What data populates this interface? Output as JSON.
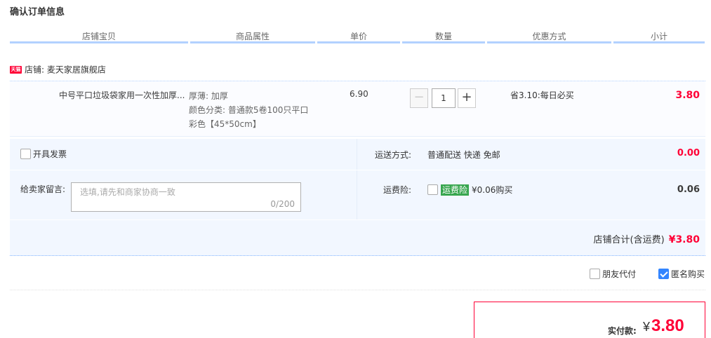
{
  "page_title": "确认订单信息",
  "columns": [
    "店铺宝贝",
    "商品属性",
    "单价",
    "数量",
    "优惠方式",
    "小计"
  ],
  "shop": {
    "badge": "天猫",
    "label": "店铺: 麦天家居旗舰店"
  },
  "item": {
    "title": "中号平口垃圾袋家用一次性加厚...",
    "attrs": [
      "厚薄: 加厚",
      "颜色分类: 普通款5卷100只平口",
      "彩色【45*50cm】"
    ],
    "price": "6.90",
    "quantity": "1",
    "minus": "−",
    "plus": "+",
    "promo": "省3.10:每日必买",
    "subtotal": "3.80"
  },
  "invoice": {
    "label": "开具发票",
    "checked": false
  },
  "shipping": {
    "label": "运送方式:",
    "value": "普通配送 快递 免邮",
    "price": "0.00"
  },
  "message": {
    "label": "给卖家留言:",
    "placeholder": "选填,请先和商家协商一致",
    "counter": "0/200"
  },
  "insurance": {
    "label": "运费险:",
    "tag": "运费险",
    "text": "¥0.06购买",
    "price": "0.06"
  },
  "shop_total": {
    "label": "店铺合计(含运费)",
    "amount": "¥3.80"
  },
  "options": {
    "friend_pay": "朋友代付",
    "anonymous": "匿名购买"
  },
  "payment": {
    "label": "实付款:",
    "symbol": "¥",
    "amount": "3.80"
  },
  "colors": {
    "accent_red": "#ff0036",
    "header_border": "#b2d1ff",
    "extra_bg": "#f2f7ff",
    "insurance_green": "#38a64f",
    "checkbox_blue": "#3385ff"
  }
}
